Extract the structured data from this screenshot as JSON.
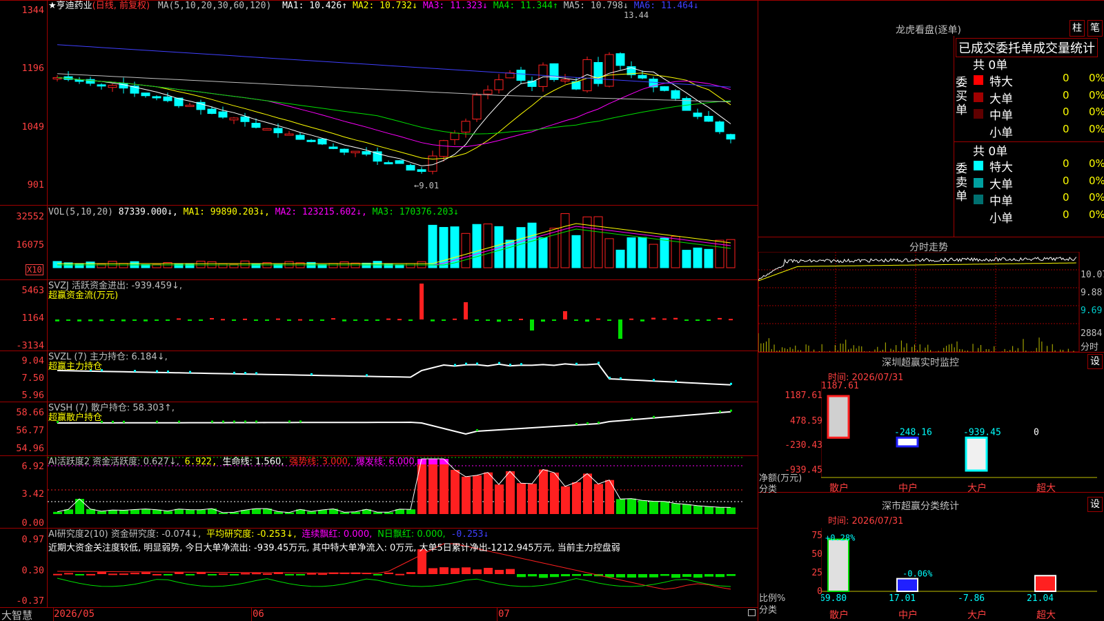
{
  "header": {
    "stock": "★亨迪药业",
    "period": "(日线, 前复权)",
    "ma_label": "MA(5,10,20,30,60,120)",
    "ma_values": [
      {
        "name": "MA1",
        "value": "10.426",
        "arrow": "↑",
        "color": "#ffffff"
      },
      {
        "name": "MA2",
        "value": "10.732",
        "arrow": "↓",
        "color": "#ffff00"
      },
      {
        "name": "MA3",
        "value": "11.323",
        "arrow": "↓",
        "color": "#ff00ff"
      },
      {
        "name": "MA4",
        "value": "11.344",
        "arrow": "↑",
        "color": "#00e000"
      },
      {
        "name": "MA5",
        "value": "10.798",
        "arrow": "↓",
        "color": "#c0c0c0"
      },
      {
        "name": "MA6",
        "value": "11.464",
        "arrow": "↓",
        "color": "#4040ff"
      }
    ],
    "high_label": "13.44",
    "low_label": "←9.01"
  },
  "price_axis": [
    "1344",
    "1196",
    "1049",
    "901"
  ],
  "volume": {
    "title": "VOL(5,10,20)",
    "value": "87339.000↓,",
    "ma1": "MA1: 99890.203↓,",
    "ma2": "MA2: 123215.602↓,",
    "ma3": "MA3: 170376.203↓",
    "axis": [
      "32552",
      "16075"
    ],
    "unit": "X10"
  },
  "svzj": {
    "title": "SVZJ  活跃资金进出: -939.459↓,",
    "subtitle": "超赢资金流(万元)",
    "axis": [
      "5463",
      "1164",
      "-3134"
    ]
  },
  "svzl": {
    "title": "SVZL (7) 主力持仓: 6.184↓,",
    "subtitle": "超赢主力持仓",
    "axis": [
      "9.04",
      "7.50",
      "5.96"
    ]
  },
  "svsh": {
    "title": "SVSH (7) 散户持仓: 58.303↑,",
    "subtitle": "超赢散户持仓",
    "axis": [
      "58.66",
      "56.77",
      "54.96"
    ]
  },
  "ai_active": {
    "title": "AI活跃度2 资金活跃度: 0.627↓,",
    "v2": "6.922,",
    "v3": "生命线: 1.560,",
    "v4": "强势线: 3.000,",
    "v5": "爆发线: 6.000,",
    "axis": [
      "6.92",
      "3.42",
      "0.00"
    ]
  },
  "ai_research": {
    "title": "AI研究度2(10) 资金研究度: -0.074↓,",
    "v2": "平均研究度: -0.253↓,",
    "v3": "连续飘红: 0.000,",
    "v4": "N日飘红: 0.000,",
    "v5": "-0.253↓",
    "desc": "近期大资金关注度较低, 明显弱势, 今日大单净流出: -939.45万元, 其中特大单净流入: 0万元, 大单5日累计净出-1212.945万元, 当前主力控盘弱",
    "axis": [
      "0.97",
      "0.30",
      "-0.37"
    ]
  },
  "date_axis": {
    "brand": "大智慧",
    "d1": "2026/05",
    "d2": "06",
    "d3": "07"
  },
  "longhu": {
    "title": "龙虎看盘(逐单)",
    "btn1": "柱",
    "btn2": "笔",
    "banner": "已成交委托单成交量统计",
    "buy_label": "委买单",
    "sell_label": "委卖单",
    "buy_total": "共 0单",
    "sell_total": "共 0单",
    "buy_rows": [
      {
        "label": "特大",
        "count": "0",
        "pct": "0%",
        "color": "#ff0000"
      },
      {
        "label": "大单",
        "count": "0",
        "pct": "0%",
        "color": "#a00000"
      },
      {
        "label": "中单",
        "count": "0",
        "pct": "0%",
        "color": "#600000"
      },
      {
        "label": "小单",
        "count": "0",
        "pct": "0%",
        "color": ""
      }
    ],
    "sell_rows": [
      {
        "label": "特大",
        "count": "0",
        "pct": "0%",
        "color": "#00ffff"
      },
      {
        "label": "大单",
        "count": "0",
        "pct": "0%",
        "color": "#00a0a0"
      },
      {
        "label": "中单",
        "count": "0",
        "pct": "0%",
        "color": "#007070"
      },
      {
        "label": "小单",
        "count": "0",
        "pct": "0%",
        "color": ""
      }
    ]
  },
  "intraday": {
    "title": "分时走势",
    "axis": [
      "10.07",
      "9.88",
      "9.69",
      "2884"
    ],
    "label": "分时"
  },
  "monitor": {
    "title": "深圳超赢实时监控",
    "btn": "设",
    "time": "时间: 2026/07/31",
    "axis": [
      "1187.61",
      "478.59",
      "-230.43",
      "-939.45"
    ],
    "top_value": "1187.61",
    "bars": [
      {
        "label": "散户",
        "value": "",
        "amount": 1187.61
      },
      {
        "label": "中户",
        "value": "-248.16",
        "amount": -248.16
      },
      {
        "label": "大户",
        "value": "-939.45",
        "amount": -939.45
      },
      {
        "label": "超大",
        "value": "0",
        "amount": 0
      }
    ],
    "left1": "净额(万元)",
    "left2": "分类"
  },
  "classify": {
    "title": "深市超赢分类统计",
    "btn": "设",
    "time": "时间: 2026/07/31",
    "axis": [
      "75",
      "50",
      "25",
      "0"
    ],
    "bars": [
      {
        "label": "散户",
        "value": "69.80",
        "change": "+0.28%"
      },
      {
        "label": "中户",
        "value": "17.01",
        "change": "-0.06%"
      },
      {
        "label": "大户",
        "value": "-7.86",
        "change": ""
      },
      {
        "label": "超大",
        "value": "21.04",
        "change": ""
      }
    ],
    "left1": "比例%",
    "left2": "分类"
  }
}
